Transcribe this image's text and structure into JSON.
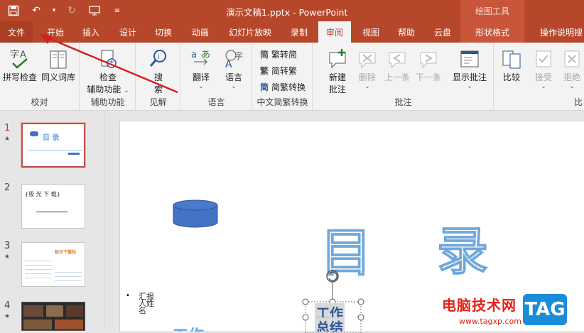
{
  "app": {
    "doc_title": "演示文稿1.pptx - PowerPoint",
    "context_title": "绘图工具"
  },
  "tabs": {
    "file": "文件",
    "home": "开始",
    "insert": "插入",
    "design": "设计",
    "transitions": "切换",
    "animations": "动画",
    "slideshow": "幻灯片放映",
    "record": "录制",
    "review": "审阅",
    "view": "视图",
    "help": "帮助",
    "cloud": "云盘",
    "shape_format": "形状格式",
    "tell_me": "操作说明搜"
  },
  "ribbon": {
    "proofing": {
      "label": "校对",
      "spell_check": "拼写检查",
      "thesaurus": "同义词库"
    },
    "accessibility": {
      "label": "辅助功能",
      "check_line1": "检查",
      "check_line2": "辅助功能"
    },
    "insights": {
      "label": "见解",
      "search_line1": "搜",
      "search_line2": "索"
    },
    "language": {
      "label": "语言",
      "translate": "翻译",
      "language": "语言"
    },
    "chinese_conversion": {
      "label": "中文简繁转换",
      "to_simplified": "繁转简",
      "to_traditional": "简转繁",
      "conversion": "简繁转换"
    },
    "comments": {
      "label": "批注",
      "new_line1": "新建",
      "new_line2": "批注",
      "delete": "删除",
      "previous": "上一条",
      "next": "下一条",
      "show": "显示批注"
    },
    "compare": {
      "compare": "比较",
      "accept": "接受",
      "reject": "拒绝",
      "label": "比"
    }
  },
  "slides": {
    "numbers": [
      "1",
      "2",
      "3",
      "4"
    ],
    "star": "★",
    "thumb1_title": "目  录",
    "thumb2_title": "{极 光 下 载}",
    "thumb3_title": "极光下载站"
  },
  "slide_content": {
    "char_1": "目",
    "char_2": "录",
    "reporter_label": "汇报人姓名",
    "selected_text_1": "工作",
    "selected_text_2": "总结",
    "partial_text": "工作"
  },
  "watermark": {
    "text": "电脑技术网",
    "url": "www.tagxp.com",
    "badge": "TAG"
  },
  "colors": {
    "accent": "#b7472a",
    "slide_char": "#6fa8dc",
    "cylinder": "#4472c4"
  }
}
